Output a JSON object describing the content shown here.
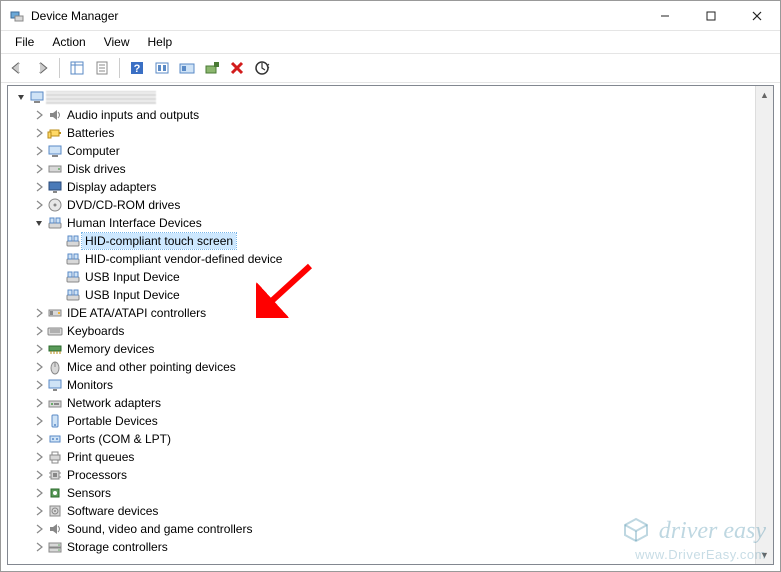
{
  "window": {
    "title": "Device Manager"
  },
  "menubar": [
    "File",
    "Action",
    "View",
    "Help"
  ],
  "toolbar": [
    {
      "name": "back",
      "title": "Back"
    },
    {
      "name": "forward",
      "title": "Forward"
    },
    {
      "sep": true
    },
    {
      "name": "show-hide",
      "title": "Show/Hide Console Tree"
    },
    {
      "name": "properties",
      "title": "Properties"
    },
    {
      "sep": true
    },
    {
      "name": "help",
      "title": "Help"
    },
    {
      "name": "action-tool",
      "title": "Action"
    },
    {
      "name": "show-hidden",
      "title": "Show hidden devices"
    },
    {
      "name": "add-hw",
      "title": "Add legacy hardware"
    },
    {
      "name": "uninstall",
      "title": "Uninstall device"
    },
    {
      "name": "scan",
      "title": "Scan for hardware changes"
    }
  ],
  "tree": {
    "root": {
      "label": "(This PC)",
      "expanded": true,
      "blurred": true
    },
    "items": [
      {
        "label": "Audio inputs and outputs",
        "icon": "audio"
      },
      {
        "label": "Batteries",
        "icon": "battery"
      },
      {
        "label": "Computer",
        "icon": "computer"
      },
      {
        "label": "Disk drives",
        "icon": "disk"
      },
      {
        "label": "Display adapters",
        "icon": "display"
      },
      {
        "label": "DVD/CD-ROM drives",
        "icon": "optical"
      },
      {
        "label": "Human Interface Devices",
        "icon": "hid",
        "expanded": true,
        "children": [
          {
            "label": "HID-compliant touch screen",
            "icon": "hid",
            "selected": true
          },
          {
            "label": "HID-compliant vendor-defined device",
            "icon": "hid"
          },
          {
            "label": "USB Input Device",
            "icon": "hid"
          },
          {
            "label": "USB Input Device",
            "icon": "hid"
          }
        ]
      },
      {
        "label": "IDE ATA/ATAPI controllers",
        "icon": "ide"
      },
      {
        "label": "Keyboards",
        "icon": "keyboard"
      },
      {
        "label": "Memory devices",
        "icon": "memory"
      },
      {
        "label": "Mice and other pointing devices",
        "icon": "mouse"
      },
      {
        "label": "Monitors",
        "icon": "monitor"
      },
      {
        "label": "Network adapters",
        "icon": "network"
      },
      {
        "label": "Portable Devices",
        "icon": "portable"
      },
      {
        "label": "Ports (COM & LPT)",
        "icon": "port"
      },
      {
        "label": "Print queues",
        "icon": "printer"
      },
      {
        "label": "Processors",
        "icon": "cpu"
      },
      {
        "label": "Sensors",
        "icon": "sensor"
      },
      {
        "label": "Software devices",
        "icon": "software"
      },
      {
        "label": "Sound, video and game controllers",
        "icon": "sound"
      },
      {
        "label": "Storage controllers",
        "icon": "storage",
        "truncated": true
      }
    ]
  },
  "watermark": {
    "brand": "driver easy",
    "url": "www.DriverEasy.com"
  }
}
